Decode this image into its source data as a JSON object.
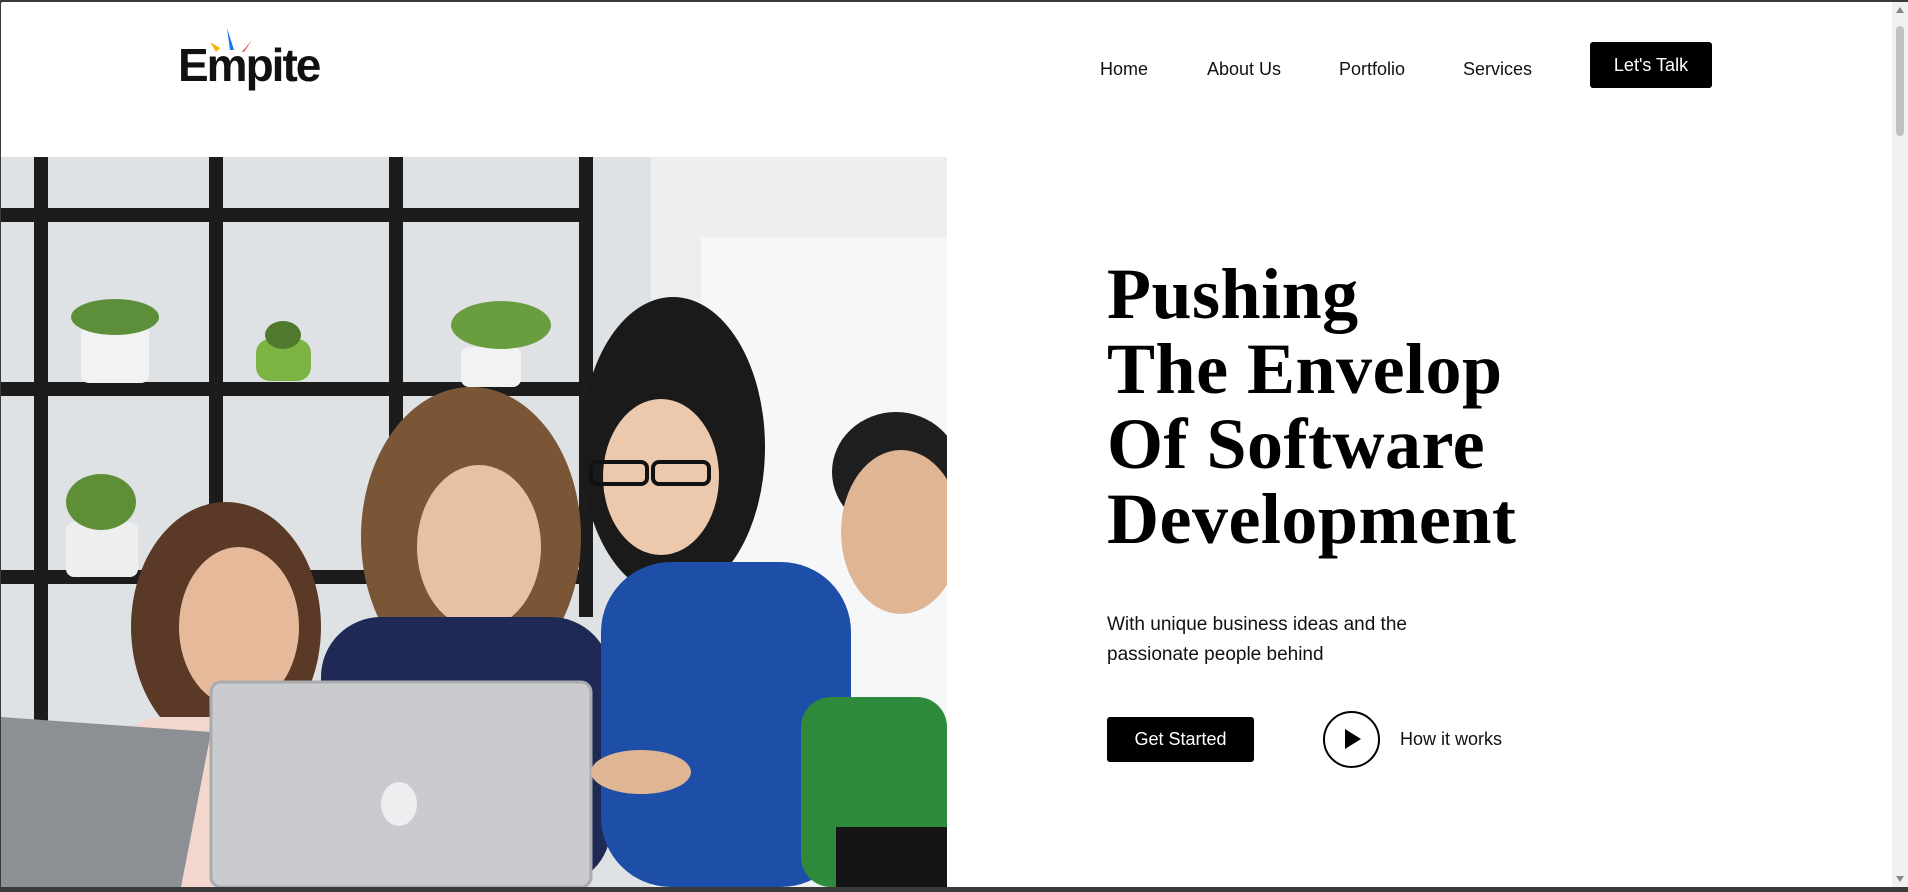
{
  "brand": {
    "name": "Empite",
    "logo_colors": [
      "#f4b400",
      "#1a73e8",
      "#e53935"
    ]
  },
  "nav": {
    "items": [
      {
        "label": "Home"
      },
      {
        "label": "About Us"
      },
      {
        "label": "Portfolio"
      },
      {
        "label": "Services"
      }
    ],
    "cta_label": "Let's Talk"
  },
  "hero": {
    "headline_lines": [
      "Pushing",
      "The Envelop",
      "Of Software",
      "Development"
    ],
    "subtitle": "With unique business ideas and the passionate people behind",
    "primary_button": "Get Started",
    "secondary_button": "How it works",
    "secondary_icon": "play-icon",
    "image_description_icon": "team-photo"
  },
  "colors": {
    "accent": "#000000",
    "background": "#ffffff",
    "text": "#111111"
  }
}
